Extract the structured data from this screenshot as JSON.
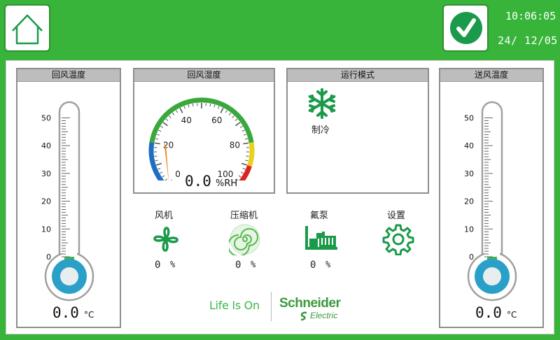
{
  "header": {
    "time": "10:06:05",
    "date": "24/ 12/05"
  },
  "left_thermo": {
    "title": "回风温度",
    "ticks": [
      "50",
      "40",
      "30",
      "20",
      "10",
      "0"
    ],
    "value": "0.0",
    "unit": "°C",
    "level": 0
  },
  "humidity": {
    "title": "回风湿度",
    "ticks": [
      "0",
      "20",
      "40",
      "60",
      "80",
      "100"
    ],
    "value": "0.0",
    "unit": "%RH",
    "level": 0,
    "colors": {
      "low": "#1e6fc4",
      "mid": "#3aa83a",
      "high": "#e8d21e",
      "alarm": "#d8261f",
      "needle": "#f07a0a"
    }
  },
  "mode": {
    "title": "运行模式",
    "label": "制冷",
    "icon": "snowflake-icon"
  },
  "right_thermo": {
    "title": "送风温度",
    "ticks": [
      "50",
      "40",
      "30",
      "20",
      "10",
      "0"
    ],
    "value": "0.0",
    "unit": "°C",
    "level": 0
  },
  "devices": [
    {
      "label": "风机",
      "value": "0",
      "unit": "%",
      "icon": "fan-icon"
    },
    {
      "label": "压缩机",
      "value": "0",
      "unit": "%",
      "icon": "compressor-icon"
    },
    {
      "label": "氟泵",
      "value": "0",
      "unit": "%",
      "icon": "pump-icon"
    }
  ],
  "settings": {
    "label": "设置",
    "icon": "gear-icon"
  },
  "branding": {
    "slogan": "Life Is On",
    "brand": "Schneider",
    "sub": "Electric"
  },
  "colors": {
    "accent": "#38b43a",
    "icon_green": "#1a9a4a",
    "thermo_fill": "#3cb84a",
    "thermo_bulb": "#2aa0c8"
  }
}
